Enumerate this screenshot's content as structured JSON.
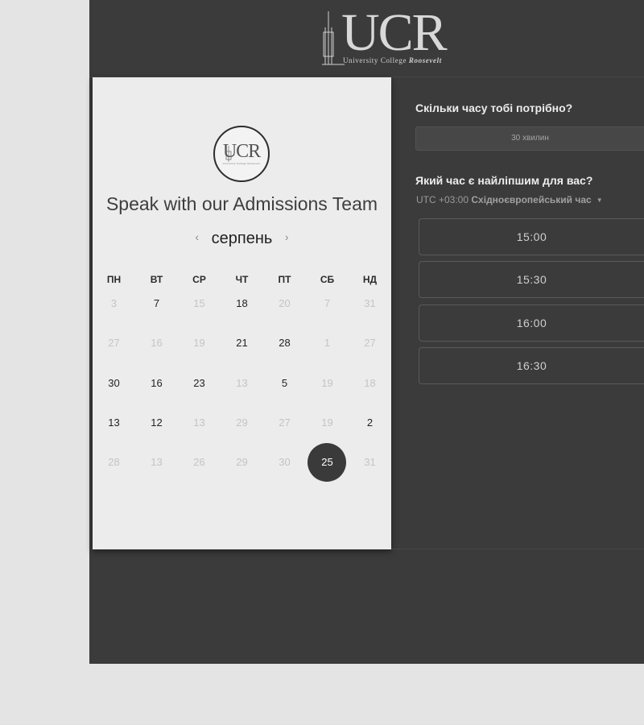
{
  "header": {
    "logo_letters": "UCR",
    "logo_tagline_prefix": "University College",
    "logo_tagline_name": "Roosevelt"
  },
  "card": {
    "logo_letters": "UCR",
    "logo_tagline": "University College Roosevelt",
    "title": "Speak with our Admissions Team",
    "month": "серпень",
    "prev_icon": "‹",
    "next_icon": "›",
    "weekdays": [
      "ПН",
      "ВТ",
      "СР",
      "ЧТ",
      "ПТ",
      "СБ",
      "НД"
    ],
    "weeks": [
      [
        "3",
        "7",
        "15",
        "18",
        "20",
        "7",
        "31"
      ],
      [
        "27",
        "16",
        "19",
        "21",
        "28",
        "1",
        "27"
      ],
      [
        "30",
        "16",
        "23",
        "13",
        "5",
        "19",
        "18"
      ],
      [
        "13",
        "12",
        "13",
        "29",
        "27",
        "19",
        "2"
      ],
      [
        "28",
        "13",
        "26",
        "29",
        "30",
        "25",
        "31"
      ]
    ],
    "selected_day": "25"
  },
  "booking": {
    "duration_question": "Скільки часу тобі потрібно?",
    "duration_value": "30 хвилин",
    "time_question": "Який час є найліпшим для вас?",
    "timezone_offset": "UTC +03:00",
    "timezone_name": "Східноєвропейський час",
    "slots": [
      "15:00",
      "15:30",
      "16:00",
      "16:30"
    ]
  },
  "colors": {
    "frame_bg": "#3b3b3b",
    "card_bg": "#ececec",
    "page_bg": "#e4e4e4",
    "selected_day_bg": "#3a3a3a"
  }
}
